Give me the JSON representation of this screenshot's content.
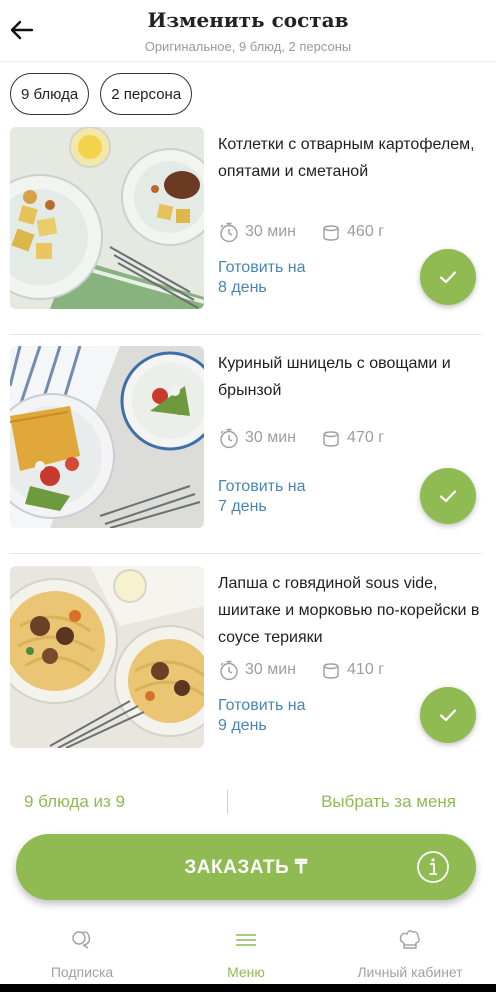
{
  "header": {
    "title": "Изменить состав",
    "subtitle": "Оригинальное, 9 блюд, 2 персоны"
  },
  "chips": [
    {
      "label": "9 блюда"
    },
    {
      "label": "2 персона"
    }
  ],
  "dishes": [
    {
      "name": "Котлетки с отварным картофелем, опятами и сметаной",
      "time": "30 мин",
      "weight": "460 г",
      "cook_line1": "Готовить на",
      "cook_line2": "8 день",
      "selected": true
    },
    {
      "name": "Куриный шницель с овощами и брынзой",
      "time": "30 мин",
      "weight": "470 г",
      "cook_line1": "Готовить на",
      "cook_line2": "7 день",
      "selected": true
    },
    {
      "name": "Лапша с говядиной sous vide, шиитаке и морковью по-корейски в соусе терияки",
      "time": "30 мин",
      "weight": "410 г",
      "cook_line1": "Готовить на",
      "cook_line2": "9 день",
      "selected": true
    }
  ],
  "summary": {
    "count_text": "9 блюда из 9",
    "auto_pick": "Выбрать за меня"
  },
  "order": {
    "label": "ЗАКАЗАТЬ ₸",
    "info_icon": "info-icon"
  },
  "nav": [
    {
      "label": "Подписка",
      "icon": "subscription-icon",
      "active": false
    },
    {
      "label": "Меню",
      "icon": "menu-icon",
      "active": true
    },
    {
      "label": "Личный кабинет",
      "icon": "chef-hat-icon",
      "active": false
    }
  ],
  "colors": {
    "accent": "#8fbb52",
    "link": "#4a85b5",
    "muted": "#9e9e9e"
  }
}
